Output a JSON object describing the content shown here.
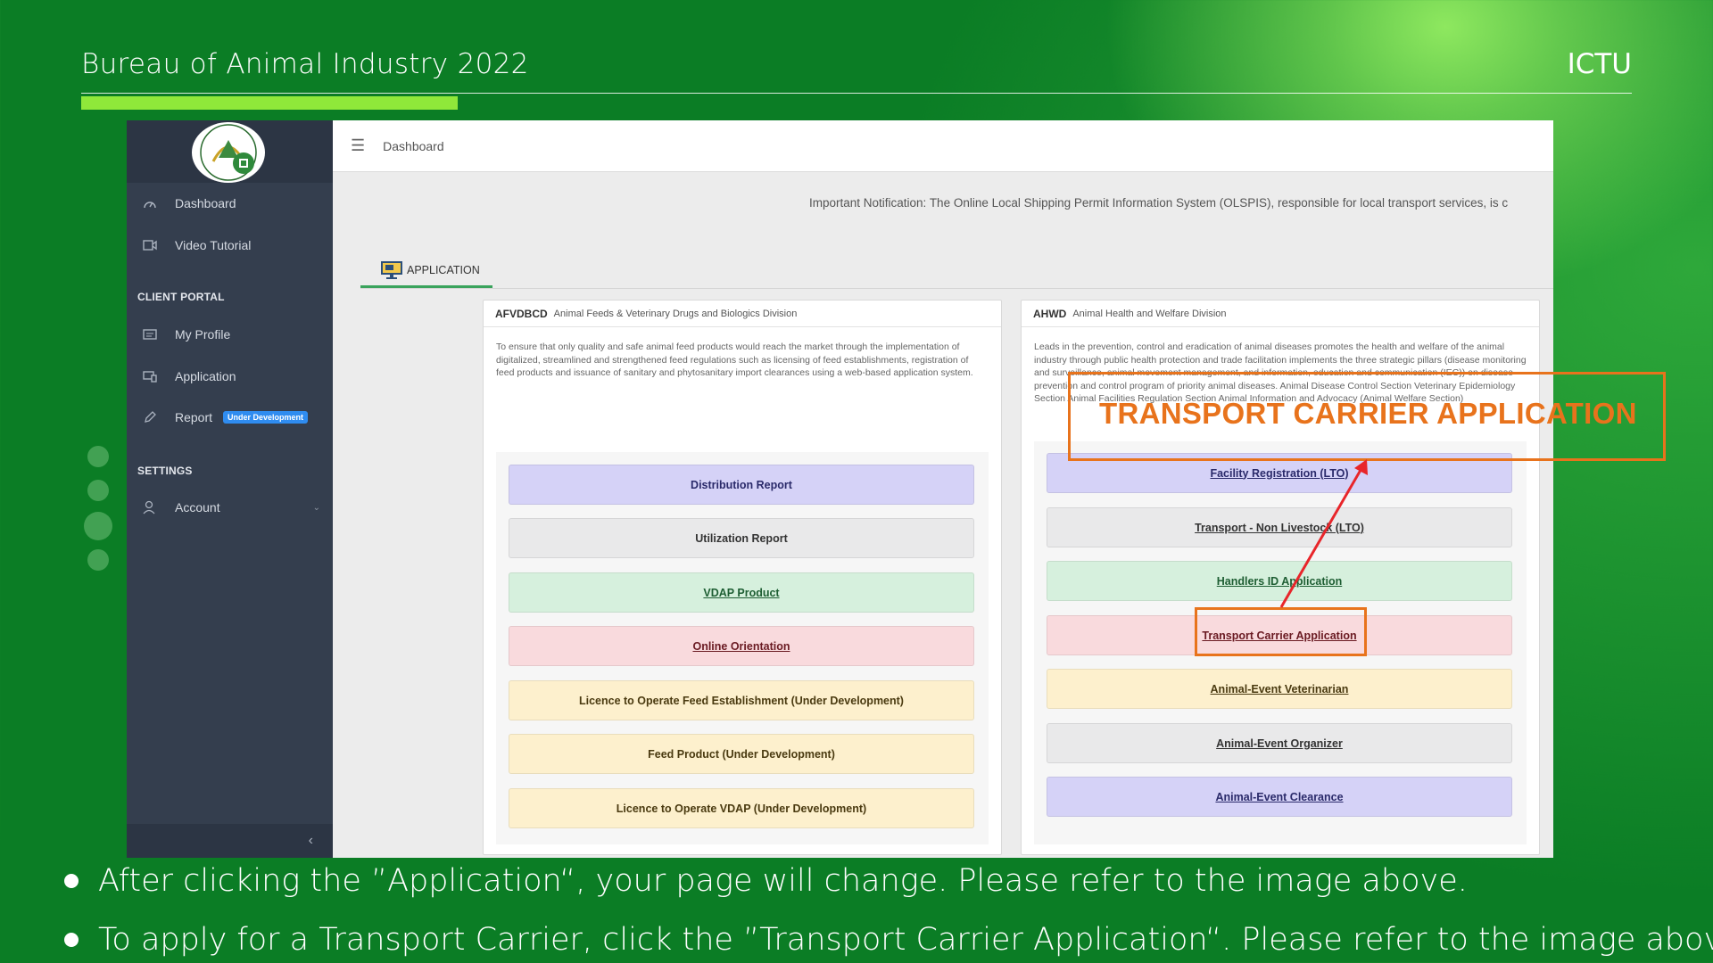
{
  "slide": {
    "title": "Bureau of Animal Industry 2022",
    "org": "ICTU",
    "bullets": [
      "After clicking the ”Application“, your page will change. Please refer to the image above.",
      "To apply for a Transport Carrier, click the ”Transport Carrier Application“. Please refer to the image above."
    ]
  },
  "sidebar": {
    "items": [
      {
        "label": "Dashboard",
        "icon": "gauge-icon"
      },
      {
        "label": "Video Tutorial",
        "icon": "video-icon"
      }
    ],
    "client_section": "CLIENT PORTAL",
    "client_items": [
      {
        "label": "My Profile",
        "icon": "profile-card-icon"
      },
      {
        "label": "Application",
        "icon": "devices-icon"
      },
      {
        "label": "Report",
        "icon": "pencil-icon",
        "badge": "Under Development"
      }
    ],
    "settings_section": "SETTINGS",
    "settings_items": [
      {
        "label": "Account",
        "icon": "user-icon"
      }
    ]
  },
  "topbar": {
    "breadcrumb": "Dashboard"
  },
  "notice": "Important Notification: The Online Local Shipping Permit Information System (OLSPIS), responsible for local transport services, is c",
  "tab": {
    "label": "APPLICATION"
  },
  "afvdbcd": {
    "code": "AFVDBCD",
    "name": "Animal Feeds & Veterinary Drugs and Biologics Division",
    "description": "To ensure that only quality and safe animal feed products would reach the market through the implementation of digitalized, streamlined and strengthened feed regulations such as licensing of feed establishments, registration of feed products and issuance of sanitary and phytosanitary import clearances using a web-based application system.",
    "buttons": [
      "Distribution Report",
      "Utilization Report",
      "VDAP Product",
      "Online Orientation",
      "Licence to Operate Feed Establishment (Under Development)",
      "Feed Product (Under Development)",
      "Licence to Operate VDAP (Under Development)"
    ]
  },
  "ahwd": {
    "code": "AHWD",
    "name": "Animal Health and Welfare Division",
    "description": "Leads in the prevention, control and eradication of animal diseases promotes the health and welfare of the animal industry through public health protection and trade facilitation implements the three strategic pillars (disease monitoring and surveillance, animal movement management, and information, education and communication (IEC)) on disease prevention and control program of priority animal diseases. Animal Disease Control Section Veterinary Epidemiology Section Animal Facilities Regulation Section Animal Information and Advocacy (Animal Welfare Section)",
    "buttons": [
      "Facility Registration (LTO)",
      "Transport - Non Livestock (LTO)",
      "Handlers ID Application",
      "Transport Carrier Application",
      "Animal-Event Veterinarian",
      "Animal-Event Organizer",
      "Animal-Event Clearance"
    ]
  },
  "annotation": {
    "label": "TRANSPORT CARRIER APPLICATION"
  },
  "colors": {
    "accent": "#e8731c",
    "slide_green": "#0b7d25",
    "sidebar": "#343e4e"
  }
}
